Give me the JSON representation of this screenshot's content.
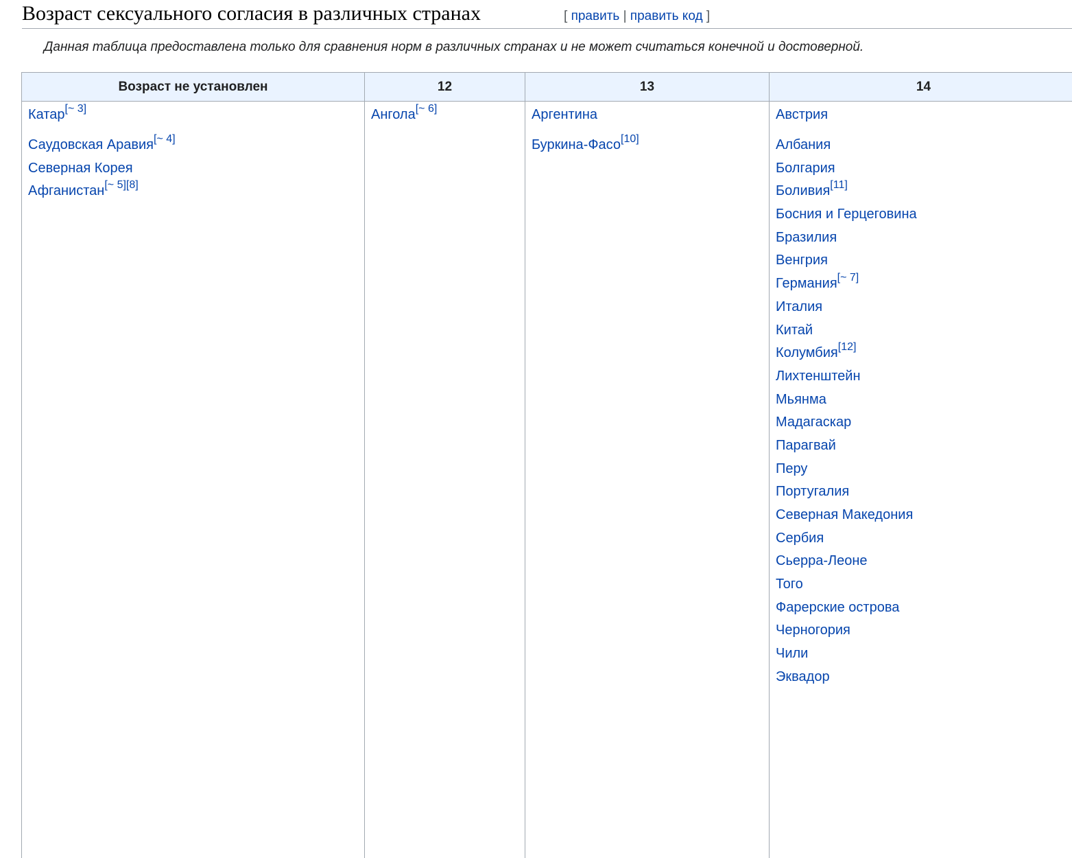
{
  "heading": {
    "title": "Возраст сексуального согласия в различных странах",
    "edit_open": "[",
    "edit_label": "править",
    "edit_sep": "|",
    "edit_code_label": "править код",
    "edit_close": "]"
  },
  "note": "Данная таблица предоставлена только для сравнения норм в различных странах и не может считаться конечной и достоверной.",
  "table": {
    "headers": [
      "Возраст не установлен",
      "12",
      "13",
      "14"
    ],
    "columns": [
      [
        {
          "name": "Катар",
          "ref": "[~ 3]"
        },
        {
          "name": "Саудовская Аравия",
          "ref": "[~ 4]"
        },
        {
          "name": "Северная Корея",
          "ref": ""
        },
        {
          "name": "Афганистан",
          "ref": "[~ 5][8]"
        }
      ],
      [
        {
          "name": "Ангола",
          "ref": "[~ 6]"
        }
      ],
      [
        {
          "name": "Аргентина",
          "ref": ""
        },
        {
          "name": "Буркина-Фасо",
          "ref": "[10]"
        }
      ],
      [
        {
          "name": "Австрия",
          "ref": ""
        },
        {
          "name": "Албания",
          "ref": ""
        },
        {
          "name": "Болгария",
          "ref": ""
        },
        {
          "name": "Боливия",
          "ref": "[11]"
        },
        {
          "name": "Босния и Герцеговина",
          "ref": ""
        },
        {
          "name": "Бразилия",
          "ref": ""
        },
        {
          "name": "Венгрия",
          "ref": ""
        },
        {
          "name": "Германия",
          "ref": "[~ 7]"
        },
        {
          "name": "Италия",
          "ref": ""
        },
        {
          "name": "Китай",
          "ref": ""
        },
        {
          "name": "Колумбия",
          "ref": "[12]"
        },
        {
          "name": "Лихтенштейн",
          "ref": ""
        },
        {
          "name": "Мьянма",
          "ref": ""
        },
        {
          "name": "Мадагаскар",
          "ref": ""
        },
        {
          "name": "Парагвай",
          "ref": ""
        },
        {
          "name": "Перу",
          "ref": ""
        },
        {
          "name": "Португалия",
          "ref": ""
        },
        {
          "name": "Северная Македония",
          "ref": ""
        },
        {
          "name": "Сербия",
          "ref": ""
        },
        {
          "name": "Сьерра-Леоне",
          "ref": ""
        },
        {
          "name": "Того",
          "ref": ""
        },
        {
          "name": "Фарерские острова",
          "ref": ""
        },
        {
          "name": "Черногория",
          "ref": ""
        },
        {
          "name": "Чили",
          "ref": ""
        },
        {
          "name": "Эквадор",
          "ref": ""
        }
      ]
    ]
  }
}
